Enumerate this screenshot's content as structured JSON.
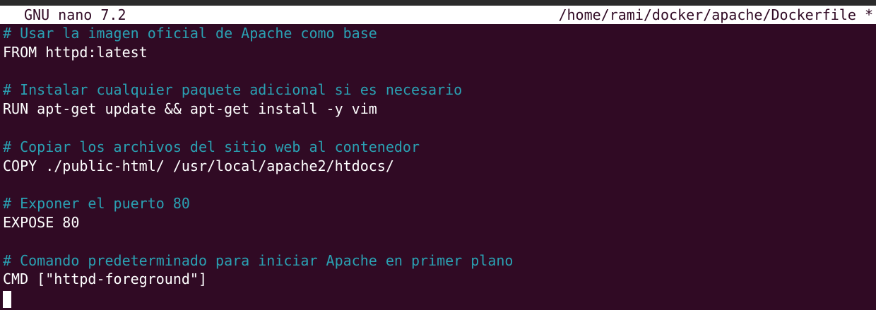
{
  "colors": {
    "background": "#300a24",
    "title_bar_bg": "#ffffff",
    "title_bar_fg": "#300a24",
    "comment": "#2aa1b3",
    "text": "#ffffff"
  },
  "title_bar": {
    "app": "GNU nano 7.2",
    "file": "/home/rami/docker/apache/Dockerfile *"
  },
  "editor": {
    "lines": [
      {
        "text": "# Usar la imagen oficial de Apache como base",
        "type": "comment"
      },
      {
        "text": "FROM httpd:latest",
        "type": "code"
      },
      {
        "text": "",
        "type": "blank"
      },
      {
        "text": "# Instalar cualquier paquete adicional si es necesario",
        "type": "comment"
      },
      {
        "text": "RUN apt-get update && apt-get install -y vim",
        "type": "code"
      },
      {
        "text": "",
        "type": "blank"
      },
      {
        "text": "# Copiar los archivos del sitio web al contenedor",
        "type": "comment"
      },
      {
        "text": "COPY ./public-html/ /usr/local/apache2/htdocs/",
        "type": "code"
      },
      {
        "text": "",
        "type": "blank"
      },
      {
        "text": "# Exponer el puerto 80",
        "type": "comment"
      },
      {
        "text": "EXPOSE 80",
        "type": "code"
      },
      {
        "text": "",
        "type": "blank"
      },
      {
        "text": "# Comando predeterminado para iniciar Apache en primer plano",
        "type": "comment"
      },
      {
        "text": "CMD [\"httpd-foreground\"]",
        "type": "code"
      }
    ]
  }
}
